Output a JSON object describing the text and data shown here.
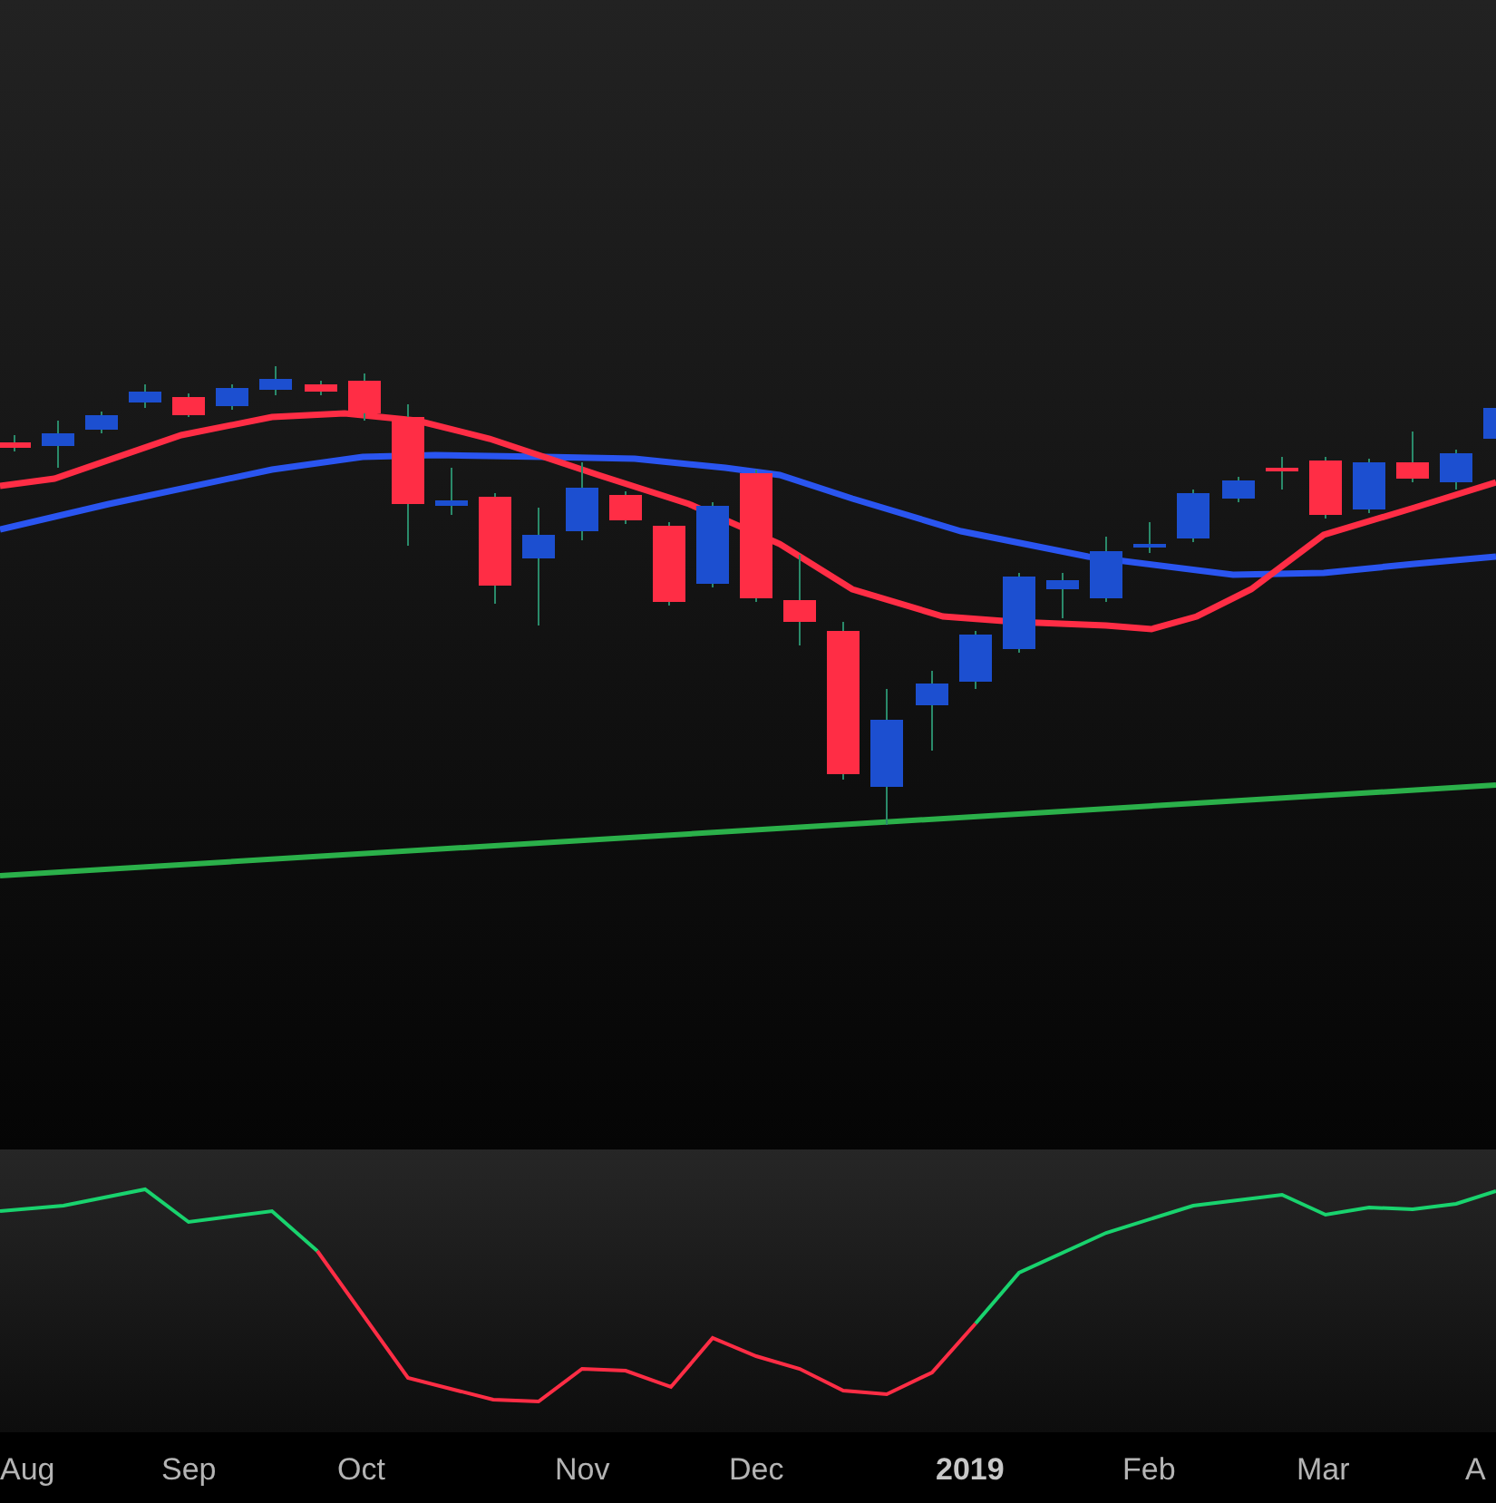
{
  "x_axis": {
    "labels": [
      {
        "text": "Aug",
        "emphasis": false
      },
      {
        "text": "Sep",
        "emphasis": false
      },
      {
        "text": "Oct",
        "emphasis": false
      },
      {
        "text": "Nov",
        "emphasis": false
      },
      {
        "text": "Dec",
        "emphasis": false
      },
      {
        "text": "2019",
        "emphasis": true
      },
      {
        "text": "Feb",
        "emphasis": false
      },
      {
        "text": "Mar",
        "emphasis": false
      },
      {
        "text": "A",
        "emphasis": false
      }
    ]
  }
}
